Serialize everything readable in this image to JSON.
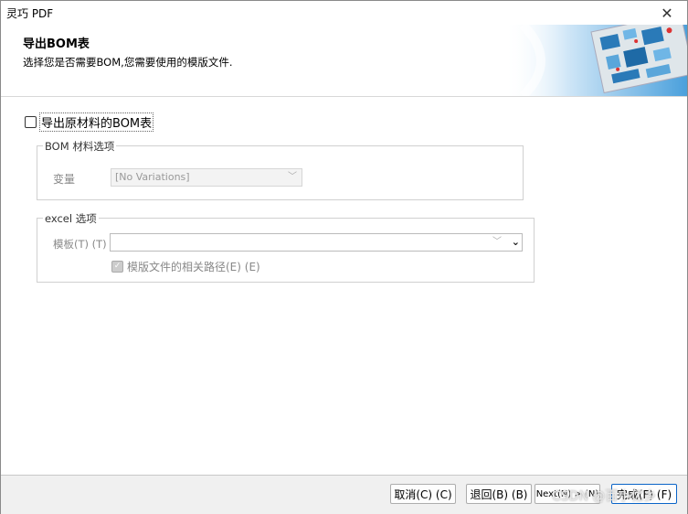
{
  "window": {
    "title": "灵巧 PDF",
    "close_glyph": "✕"
  },
  "header": {
    "title": "导出BOM表",
    "description": "选择您是否需要BOM,您需要使用的模版文件."
  },
  "main_checkbox": {
    "label": "导出原材料的BOM表",
    "checked": false
  },
  "bom_group": {
    "legend": "BOM 材料选项",
    "variation_label": "变量",
    "variation_value": "[No Variations]"
  },
  "excel_group": {
    "legend": "excel 选项",
    "template_label": "模板(T) (T)",
    "template_value": "",
    "relative_path_label": "模版文件的相关路径(E) (E)",
    "relative_path_checked": true
  },
  "buttons": {
    "cancel": "取消(C) (C)",
    "back": "退回(B) (B)",
    "next": "Next(N) > (N)",
    "finish": "完成(F) (F)"
  },
  "watermark": "CSDN @百小亿乡",
  "colors": {
    "focus_border": "#0a64c8",
    "disabled_text": "#888888"
  }
}
